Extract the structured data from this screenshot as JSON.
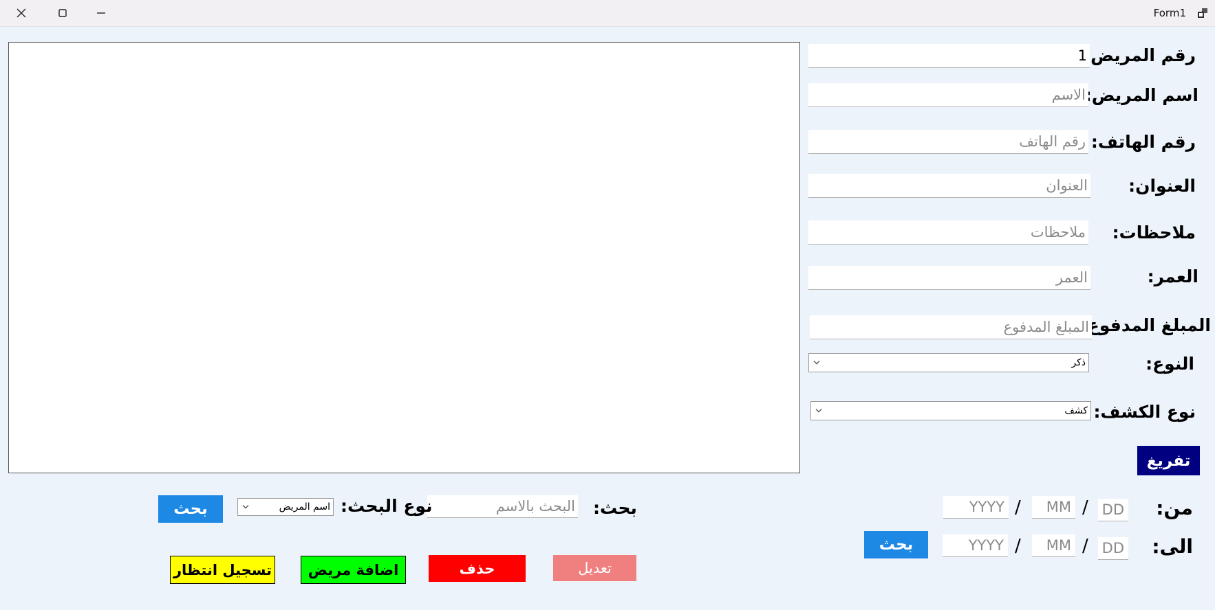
{
  "window": {
    "title": "Form1"
  },
  "form": {
    "patient_number": {
      "label": "رقم المريض:",
      "value": "1"
    },
    "patient_name": {
      "label": "اسم المريض:",
      "placeholder": "الاسم"
    },
    "phone": {
      "label": "رقم الهاتف:",
      "placeholder": "رقم الهاتف"
    },
    "address": {
      "label": "العنوان:",
      "placeholder": "العنوان"
    },
    "notes": {
      "label": "ملاحظات:",
      "placeholder": "ملاحظات"
    },
    "age": {
      "label": "العمر:",
      "placeholder": "العمر"
    },
    "amount_paid": {
      "label": "المبلغ المدفوع:",
      "placeholder": "المبلغ المدفوع"
    },
    "gender": {
      "label": "النوع:",
      "selected": "ذكر"
    },
    "visit_type": {
      "label": "نوع الكشف:",
      "selected": "كشف"
    },
    "clear_label": "تفريغ"
  },
  "date_filter": {
    "from_label": "من:",
    "to_label": "الى:",
    "day_placeholder": "DD",
    "month_placeholder": "MM",
    "year_placeholder": "YYYY",
    "separator": "/",
    "search_label": "بحث"
  },
  "search": {
    "label": "بحث:",
    "placeholder": "البحث بالاسم",
    "type_label": "نوع البحث:",
    "type_selected": "اسم المريض",
    "button_label": "بحث"
  },
  "actions": {
    "edit_label": "تعديل",
    "delete_label": "حذف",
    "add_label": "اضافة مريض",
    "wait_label": "تسجيل انتظار"
  },
  "colors": {
    "blue_button": "#1e88e5",
    "navy_button": "#000080",
    "edit_button": "#f08080",
    "delete_button": "#ff0000",
    "add_button": "#00ff00",
    "wait_button": "#ffff00"
  }
}
